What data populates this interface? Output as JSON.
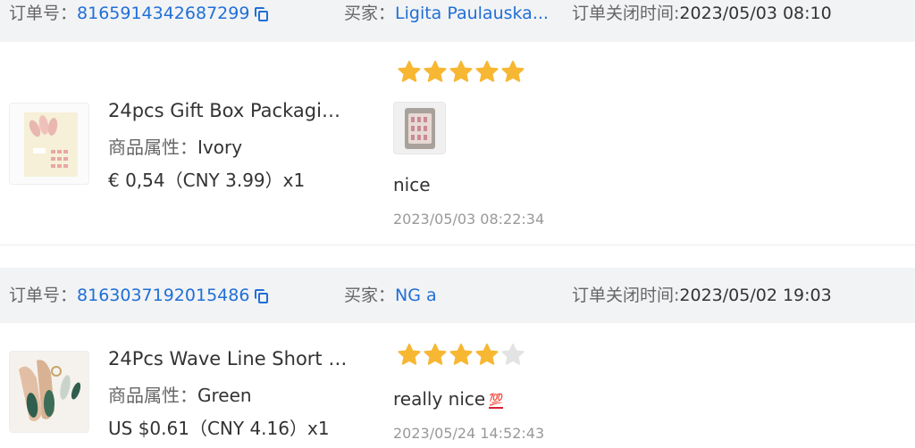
{
  "orders": [
    {
      "order_label": "订单号：",
      "order_number": "8165914342687299",
      "buyer_label": "买家：",
      "buyer_name": "Ligita Paulauska...",
      "close_time_label": "订单关闭时间:",
      "close_time": "2023/05/03 08:10",
      "product": {
        "title": "24pcs Gift Box Packaging ...",
        "attr_label": "商品属性：",
        "attr_value": "Ivory",
        "price": "€ 0,54（CNY  3.99）x1"
      },
      "review": {
        "rating": 5,
        "max_rating": 5,
        "text": "nice",
        "time": "2023/05/03 08:22:34",
        "has_image": true
      }
    },
    {
      "order_label": "订单号：",
      "order_number": "8163037192015486",
      "buyer_label": "买家：",
      "buyer_name": "NG a",
      "close_time_label": "订单关闭时间:",
      "close_time": "2023/05/02 19:03",
      "product": {
        "title": "24Pcs Wave Line Short Ba...",
        "attr_label": "商品属性：",
        "attr_value": "Green",
        "price": "US $0.61（CNY  4.16）x1"
      },
      "review": {
        "rating": 4,
        "max_rating": 5,
        "text": "really nice",
        "emoji": "💯",
        "time": "2023/05/24 14:52:43",
        "has_image": false
      }
    }
  ],
  "colors": {
    "link": "#1f6fd6",
    "header_bg": "#f2f3f5",
    "star_filled": "#f7b733",
    "star_empty": "#e3e3e3"
  }
}
